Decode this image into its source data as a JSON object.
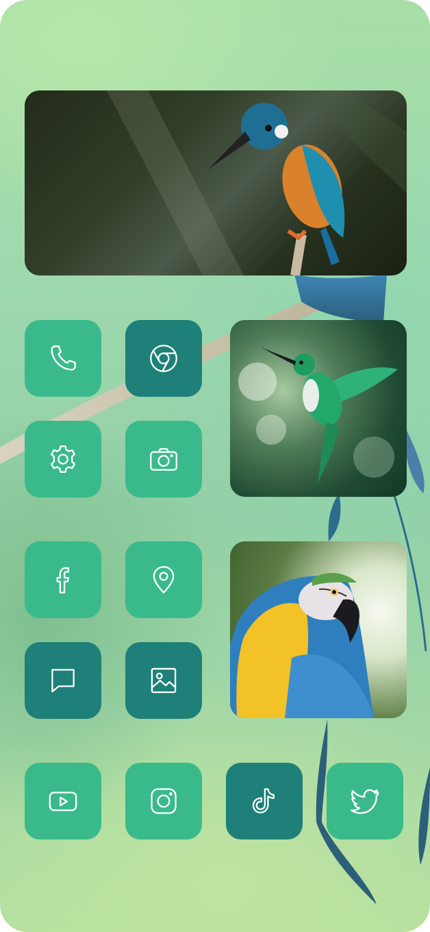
{
  "wallpaper": {
    "subject": "blue-and-gold macaw tail and branch"
  },
  "widgets": [
    {
      "id": "kingfisher",
      "alt": "Kingfisher on a branch"
    },
    {
      "id": "hummingbird",
      "alt": "Green hummingbird in flight"
    },
    {
      "id": "macaw",
      "alt": "Blue-and-gold macaw"
    }
  ],
  "apps": [
    {
      "id": "phone",
      "label": "Phone",
      "icon": "phone-icon",
      "color": "#3aba8a"
    },
    {
      "id": "chrome",
      "label": "Chrome",
      "icon": "chrome-icon",
      "color": "#1e8078"
    },
    {
      "id": "settings",
      "label": "Settings",
      "icon": "gear-icon",
      "color": "#3aba8a"
    },
    {
      "id": "camera",
      "label": "Camera",
      "icon": "camera-icon",
      "color": "#3aba8a"
    },
    {
      "id": "facebook",
      "label": "Facebook",
      "icon": "facebook-icon",
      "color": "#3aba8a"
    },
    {
      "id": "maps",
      "label": "Maps",
      "icon": "location-pin-icon",
      "color": "#3aba8a"
    },
    {
      "id": "messages",
      "label": "Messages",
      "icon": "chat-bubble-icon",
      "color": "#1e8078"
    },
    {
      "id": "gallery",
      "label": "Gallery",
      "icon": "image-icon",
      "color": "#1e8078"
    },
    {
      "id": "youtube",
      "label": "YouTube",
      "icon": "youtube-icon",
      "color": "#3aba8a"
    },
    {
      "id": "instagram",
      "label": "Instagram",
      "icon": "instagram-icon",
      "color": "#3aba8a"
    },
    {
      "id": "tiktok",
      "label": "TikTok",
      "icon": "tiktok-icon",
      "color": "#1e8078"
    },
    {
      "id": "twitter",
      "label": "Twitter",
      "icon": "twitter-icon",
      "color": "#3aba8a"
    }
  ],
  "colors": {
    "icon_light": "#3aba8a",
    "icon_dark": "#1e8078",
    "glyph": "#ffffff"
  }
}
